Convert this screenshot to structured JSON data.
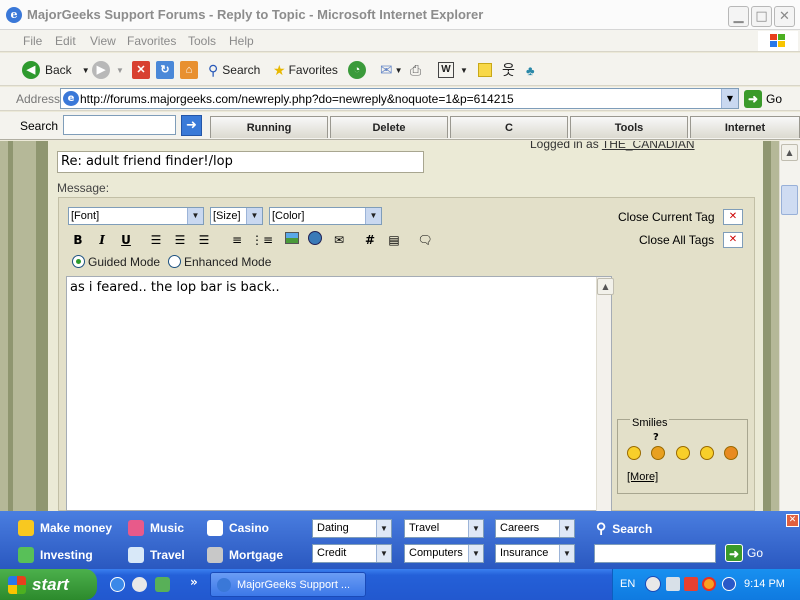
{
  "window": {
    "title": "MajorGeeks Support Forums - Reply to Topic - Microsoft Internet Explorer",
    "icon": "ie-icon",
    "controls": [
      "minimize",
      "maximize",
      "close"
    ]
  },
  "menu": [
    "File",
    "Edit",
    "View",
    "Favorites",
    "Tools",
    "Help"
  ],
  "toolbar": {
    "back_label": "Back",
    "search_label": "Search",
    "favorites_label": "Favorites"
  },
  "address": {
    "label": "Address",
    "url": "http://forums.majorgeeks.com/newreply.php?do=newreply&noquote=1&p=614215",
    "go_label": "Go"
  },
  "searchbar": {
    "label": "Search",
    "tabs": [
      "Running",
      "Delete",
      "C",
      "Tools",
      "Internet"
    ]
  },
  "page": {
    "logged_in_prefix": "Logged in as",
    "logged_in_user": "THE_CANADIAN",
    "title_value": "Re:  adult friend finder!/lop",
    "message_label": "Message:",
    "font_select": "[Font]",
    "size_select": "[Size]",
    "color_select": "[Color]",
    "close_current_tag": "Close Current Tag",
    "close_all_tags": "Close All Tags",
    "guided_mode": "Guided Mode",
    "enhanced_mode": "Enhanced Mode",
    "selected_mode": "Guided Mode",
    "message_text": "as i feared.. the lop bar is back..",
    "smilies_title": "Smilies",
    "smilies_more": "[More]"
  },
  "bottom_toolbar": {
    "links_row1": [
      "Make money",
      "Music",
      "Casino"
    ],
    "links_row2": [
      "Investing",
      "Travel",
      "Mortgage"
    ],
    "selects_row1": [
      "Dating",
      "Travel",
      "Careers"
    ],
    "selects_row2": [
      "Credit",
      "Computers",
      "Insurance"
    ],
    "search_label": "Search",
    "go_label": "Go"
  },
  "taskbar": {
    "start_label": "start",
    "task_item": "MajorGeeks Support ...",
    "language": "EN",
    "clock": "9:14 PM"
  }
}
